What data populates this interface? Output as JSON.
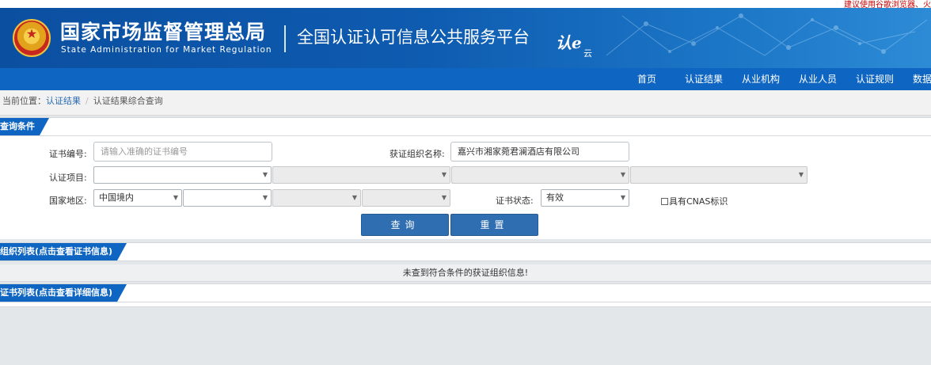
{
  "top_hint": "建议使用谷歌浏览器、火",
  "header": {
    "agency_cn": "国家市场监督管理总局",
    "agency_en": "State Administration for Market Regulation",
    "platform": "全国认证认可信息公共服务平台",
    "logo_text": "认e",
    "logo_sub": "云"
  },
  "nav": {
    "items": [
      "首页",
      "认证结果",
      "从业机构",
      "从业人员",
      "认证规则",
      "数据"
    ]
  },
  "breadcrumb": {
    "prefix": "当前位置：",
    "link": "认证结果",
    "sep": "/",
    "current": "认证结果综合查询"
  },
  "query_section": {
    "title": "查询条件",
    "cert_no_label": "证书编号:",
    "cert_no_placeholder": "请输入准确的证书编号",
    "org_name_label": "获证组织名称:",
    "org_name_value": "嘉兴市湘家菀君澜酒店有限公司",
    "project_label": "认证项目:",
    "region_label": "国家地区:",
    "region_value": "中国境内",
    "status_label": "证书状态:",
    "status_value": "有效",
    "cnas_label": "具有CNAS标识",
    "search_button": "查询",
    "reset_button": "重置"
  },
  "org_section": {
    "title": "组织列表(点击查看证书信息)",
    "empty_message": "未查到符合条件的获证组织信息!"
  },
  "cert_section": {
    "title": "证书列表(点击查看详细信息)"
  }
}
